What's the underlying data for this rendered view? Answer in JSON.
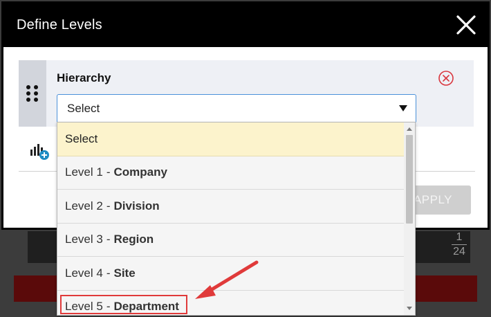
{
  "modal": {
    "title": "Define Levels",
    "close_icon": "close-icon"
  },
  "level": {
    "label": "Hierarchy",
    "drag_icon": "drag-handle-icon",
    "remove_icon": "remove-circle-icon",
    "select_value": "Select"
  },
  "add_level_icon": "add-level-icon",
  "apply_label": "APPLY",
  "dropdown": {
    "options": [
      {
        "prefix": "Select",
        "name": "",
        "selected": true
      },
      {
        "prefix": "Level 1",
        "name": "Company",
        "selected": false
      },
      {
        "prefix": "Level 2",
        "name": "Division",
        "selected": false
      },
      {
        "prefix": "Level 3",
        "name": "Region",
        "selected": false
      },
      {
        "prefix": "Level 4",
        "name": "Site",
        "selected": false
      },
      {
        "prefix": "Level 5",
        "name": "Department",
        "selected": false
      }
    ]
  },
  "background": {
    "counter_top": "1",
    "counter_bottom": "24"
  },
  "colors": {
    "header_bg": "#000000",
    "selected_option_bg": "#fcf3cc",
    "annotation_red": "#e03a3a",
    "select_border": "#4a90d9",
    "remove_icon_red": "#d9363e",
    "add_icon_blue": "#1e8bc3"
  }
}
